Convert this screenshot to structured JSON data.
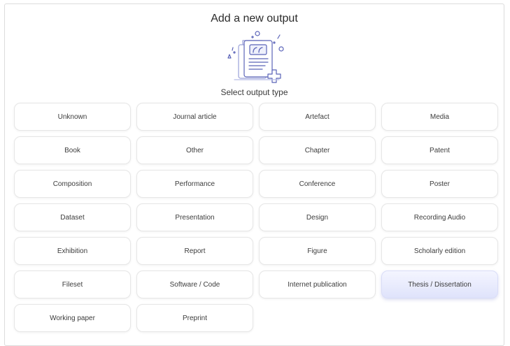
{
  "dialog": {
    "title": "Add a new output",
    "subtitle": "Select output type",
    "illustration_icon": "document-with-quotes-and-plus-icon",
    "accent_color": "#6673d9",
    "selected_tile_color": "#e3e7fc"
  },
  "output_types": [
    {
      "label": "Unknown"
    },
    {
      "label": "Journal article"
    },
    {
      "label": "Artefact"
    },
    {
      "label": "Media"
    },
    {
      "label": "Book"
    },
    {
      "label": "Other"
    },
    {
      "label": "Chapter"
    },
    {
      "label": "Patent"
    },
    {
      "label": "Composition"
    },
    {
      "label": "Performance"
    },
    {
      "label": "Conference"
    },
    {
      "label": "Poster"
    },
    {
      "label": "Dataset"
    },
    {
      "label": "Presentation"
    },
    {
      "label": "Design"
    },
    {
      "label": "Recording Audio"
    },
    {
      "label": "Exhibition"
    },
    {
      "label": "Report"
    },
    {
      "label": "Figure"
    },
    {
      "label": "Scholarly edition"
    },
    {
      "label": "Fileset"
    },
    {
      "label": "Software / Code"
    },
    {
      "label": "Internet publication"
    },
    {
      "label": "Thesis / Dissertation",
      "selected": true
    },
    {
      "label": "Working paper"
    },
    {
      "label": "Preprint"
    }
  ]
}
